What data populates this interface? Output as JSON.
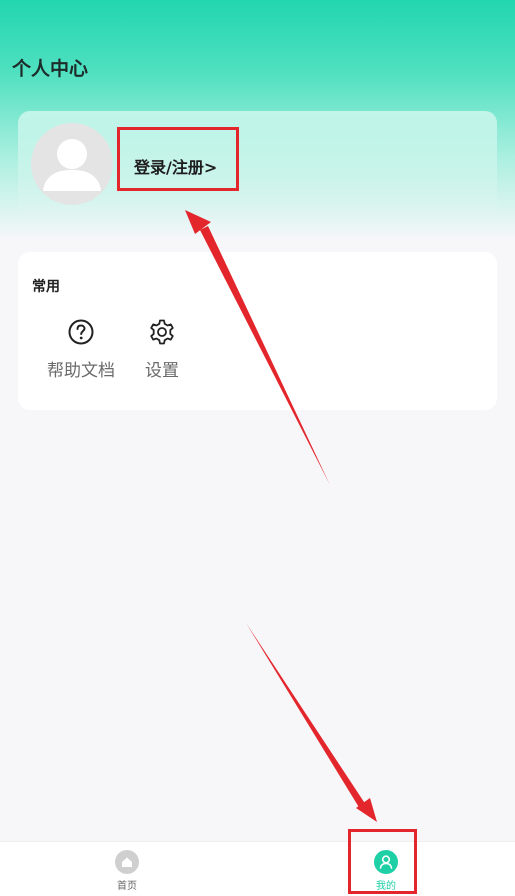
{
  "header": {
    "title": "个人中心"
  },
  "profile": {
    "login_label": "登录/注册>"
  },
  "common": {
    "title": "常用",
    "items": [
      {
        "label": "帮助文档",
        "icon": "help-circle-icon"
      },
      {
        "label": "设置",
        "icon": "gear-icon"
      }
    ]
  },
  "tabbar": {
    "tabs": [
      {
        "label": "首页",
        "icon": "home-icon",
        "active": false
      },
      {
        "label": "我的",
        "icon": "user-icon",
        "active": true
      }
    ]
  },
  "colors": {
    "accent": "#1fcfa6",
    "highlight": "#e3262c",
    "inactive_tab": "#c8c8c8"
  }
}
